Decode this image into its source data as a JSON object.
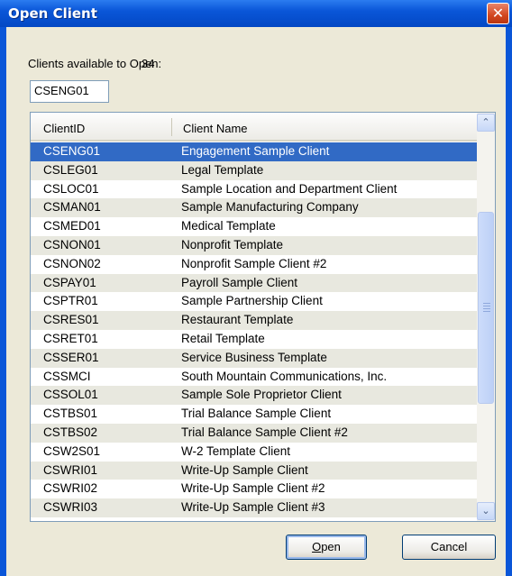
{
  "window": {
    "title": "Open Client",
    "close_glyph": "✕"
  },
  "available": {
    "label": "Clients available to Open:",
    "count": "34"
  },
  "filter": {
    "value": "CSENG01"
  },
  "list": {
    "columns": [
      "ClientID",
      "Client Name"
    ],
    "selected_index": 0,
    "rows": [
      {
        "id": "CSENG01",
        "name": "Engagement Sample Client"
      },
      {
        "id": "CSLEG01",
        "name": "Legal Template"
      },
      {
        "id": "CSLOC01",
        "name": "Sample Location and Department Client"
      },
      {
        "id": "CSMAN01",
        "name": "Sample Manufacturing Company"
      },
      {
        "id": "CSMED01",
        "name": "Medical Template"
      },
      {
        "id": "CSNON01",
        "name": "Nonprofit Template"
      },
      {
        "id": "CSNON02",
        "name": "Nonprofit Sample Client #2"
      },
      {
        "id": "CSPAY01",
        "name": "Payroll Sample Client"
      },
      {
        "id": "CSPTR01",
        "name": "Sample Partnership Client"
      },
      {
        "id": "CSRES01",
        "name": "Restaurant Template"
      },
      {
        "id": "CSRET01",
        "name": "Retail Template"
      },
      {
        "id": "CSSER01",
        "name": "Service Business Template"
      },
      {
        "id": "CSSMCI",
        "name": "South Mountain Communications, Inc."
      },
      {
        "id": "CSSOL01",
        "name": "Sample Sole Proprietor Client"
      },
      {
        "id": "CSTBS01",
        "name": "Trial Balance Sample Client"
      },
      {
        "id": "CSTBS02",
        "name": "Trial Balance Sample Client #2"
      },
      {
        "id": "CSW2S01",
        "name": "W-2 Template Client"
      },
      {
        "id": "CSWRI01",
        "name": "Write-Up Sample Client"
      },
      {
        "id": "CSWRI02",
        "name": "Write-Up Sample Client #2"
      },
      {
        "id": "CSWRI03",
        "name": "Write-Up Sample Client #3"
      }
    ]
  },
  "scrollbar": {
    "up_glyph": "⌃",
    "down_glyph": "⌄"
  },
  "buttons": {
    "open_underlined": "O",
    "open_rest": "pen",
    "cancel": "Cancel"
  },
  "colors": {
    "titlebar": "#0a56d8",
    "selection": "#316ac5",
    "dialog_bg": "#ece9d8",
    "close": "#d2461f"
  }
}
